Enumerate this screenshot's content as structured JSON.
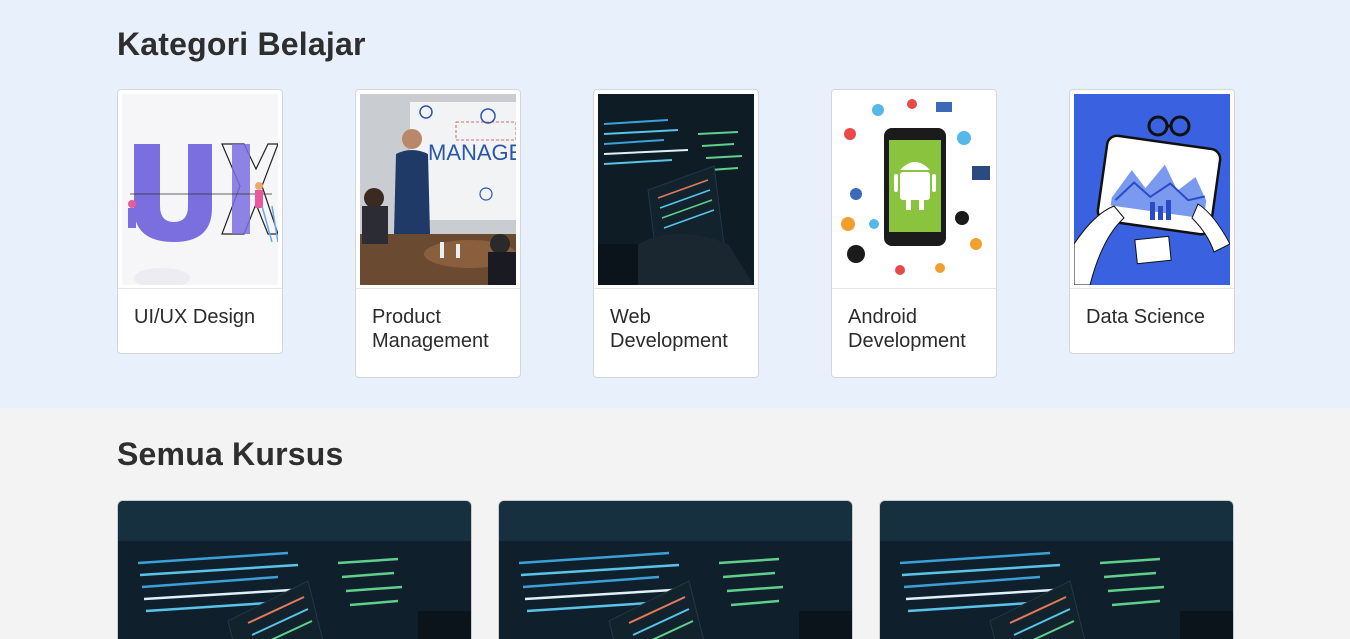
{
  "categories_section": {
    "title": "Kategori Belajar",
    "items": [
      {
        "label": "UI/UX Design",
        "image": "ux-illustration"
      },
      {
        "label": "Product Management",
        "image": "management-meeting-photo"
      },
      {
        "label": "Web Development",
        "image": "code-screen-photo"
      },
      {
        "label": "Android Development",
        "image": "android-phone-illustration"
      },
      {
        "label": "Data Science",
        "image": "data-chart-illustration"
      }
    ]
  },
  "courses_section": {
    "title": "Semua Kursus",
    "cards": [
      {
        "image": "code-screen-photo"
      },
      {
        "image": "code-screen-photo"
      },
      {
        "image": "code-screen-photo"
      }
    ]
  },
  "colors": {
    "category_bg": "#e8f1fb",
    "page_bg": "#f3f3f3",
    "ux_purple": "#7b6fe0",
    "data_blue": "#3a62e0",
    "android_green": "#8ac43f"
  }
}
